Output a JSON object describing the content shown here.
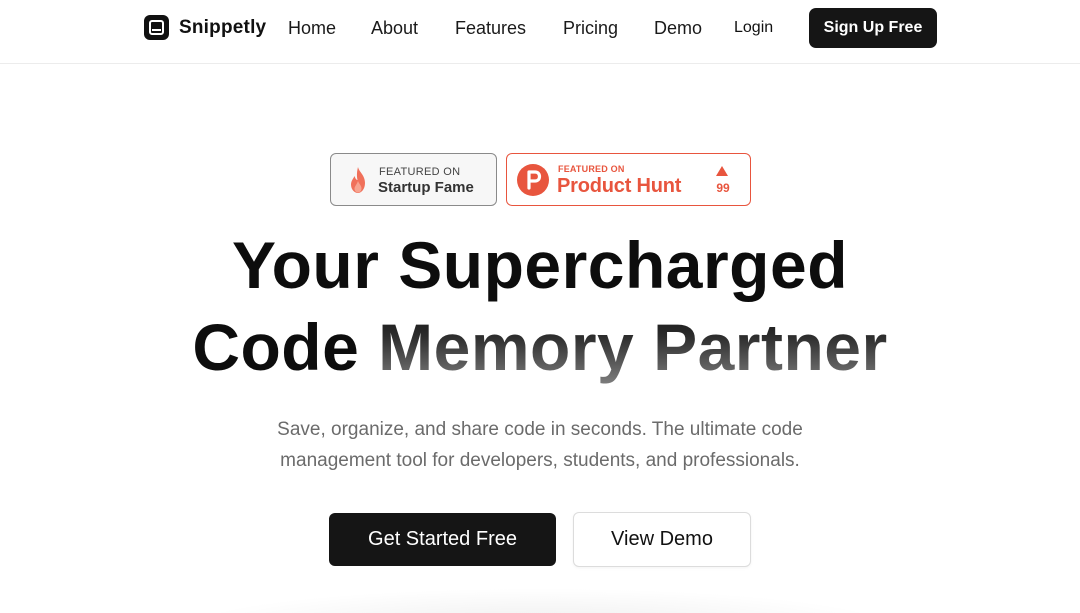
{
  "header": {
    "brand": "Snippetly",
    "logo_icon": "code-window-icon",
    "nav": [
      {
        "label": "Home"
      },
      {
        "label": "About"
      },
      {
        "label": "Features"
      },
      {
        "label": "Pricing"
      },
      {
        "label": "Demo"
      }
    ],
    "login_label": "Login",
    "signup_label": "Sign Up Free"
  },
  "badges": {
    "startup_fame": {
      "small": "FEATURED ON",
      "big": "Startup Fame",
      "icon": "flame-icon",
      "color": "#f0705a"
    },
    "product_hunt": {
      "small": "FEATURED ON",
      "big": "Product Hunt",
      "votes": "99",
      "icon": "product-hunt-p-icon",
      "color": "#e8553e"
    }
  },
  "hero": {
    "title_line1": "Your Supercharged",
    "title_line2_plain": "Code",
    "title_line2_gradient": "Memory Partner",
    "subtitle_line1": "Save, organize, and share code in seconds. The ultimate code",
    "subtitle_line2": "management tool for developers, students, and professionals.",
    "primary_cta": "Get Started Free",
    "secondary_cta": "View Demo"
  },
  "colors": {
    "primary": "#151515",
    "text_muted": "#6b6b6b",
    "product_hunt": "#e8553e"
  }
}
